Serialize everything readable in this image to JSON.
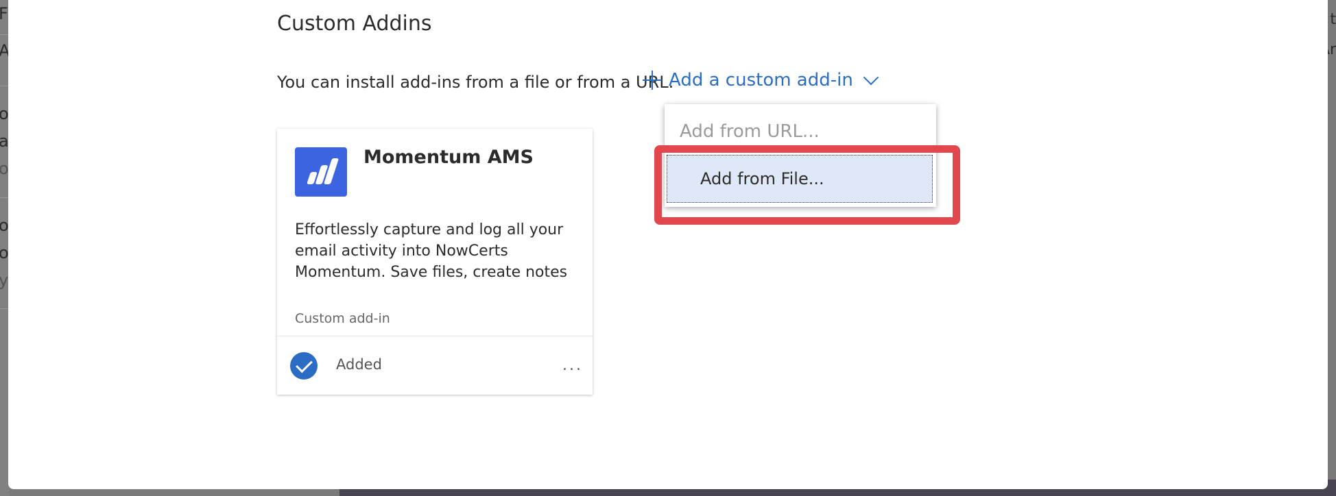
{
  "background": {
    "left_fragments": [
      "F",
      "A",
      "o",
      "a",
      "o",
      "o",
      "o",
      "y"
    ],
    "right_fragments": [
      "t",
      "Ar"
    ]
  },
  "dialog": {
    "title": "Custom Addins",
    "intro": "You can install add-ins from a file or from a URL.",
    "add_button_label": "Add a custom add-in",
    "dropdown": {
      "items": [
        {
          "label": "Add from URL..."
        },
        {
          "label": "Add from File..."
        }
      ],
      "highlighted_item": "Add from File..."
    },
    "highlight_color": "#e2474d"
  },
  "addin_card": {
    "name": "Momentum AMS",
    "description": "Effortlessly capture and log all your email activity into NowCerts Momentum. Save files, create notes",
    "type_label": "Custom add-in",
    "status": "Added",
    "more_label": "...",
    "logo_color": "#3c63e0",
    "status_color": "#2b6cc4"
  },
  "icons": [
    "plus-icon",
    "chevron-down-icon",
    "momentum-logo-icon",
    "check-circle-icon",
    "more-icon"
  ]
}
